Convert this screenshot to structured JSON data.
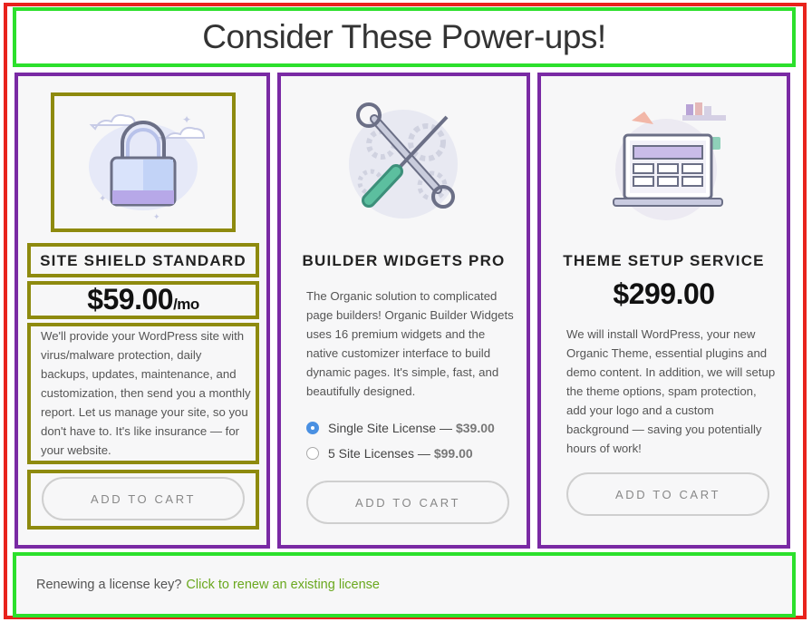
{
  "header": {
    "title": "Consider These Power-ups!"
  },
  "products": [
    {
      "title": "SITE SHIELD STANDARD",
      "price": "$59.00",
      "price_suffix": "/mo",
      "description": "We'll provide your WordPress site with virus/malware protection, daily backups, updates, maintenance, and customization, then send you a monthly report. Let us manage your site, so you don't have to. It's like insurance — for your website.",
      "button": "ADD TO CART",
      "icon": "padlock-icon"
    },
    {
      "title": "BUILDER WIDGETS PRO",
      "description": "The Organic solution to complicated page builders! Organic Builder Widgets uses 16 premium widgets and the native customizer interface to build dynamic pages. It's simple, fast, and beautifully designed.",
      "licenses": [
        {
          "label": "Single Site License —",
          "price": "$39.00",
          "selected": true
        },
        {
          "label": "5 Site Licenses —",
          "price": "$99.00",
          "selected": false
        }
      ],
      "button": "ADD TO CART",
      "icon": "tools-icon"
    },
    {
      "title": "THEME SETUP SERVICE",
      "price": "$299.00",
      "description": "We will install WordPress, your new Organic Theme, essential plugins and demo content. In addition, we will setup the theme options, spam protection, add your logo and a custom background — saving you potentially hours of work!",
      "button": "ADD TO CART",
      "icon": "laptop-workspace-icon"
    }
  ],
  "footer": {
    "text": "Renewing a license key?",
    "link": "Click to renew an existing license"
  },
  "colors": {
    "outer_border": "#e8231c",
    "section_border": "#2ce02c",
    "card_border": "#7a2aa4",
    "element_border": "#8e8a0e",
    "link": "#6aa81e",
    "radio_selected": "#4a90e2"
  }
}
